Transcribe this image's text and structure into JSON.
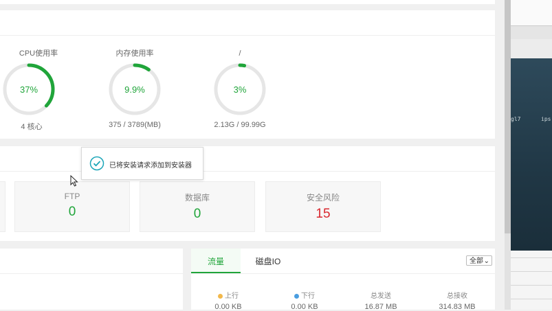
{
  "gauges": [
    {
      "title": "CPU使用率",
      "value": "37%",
      "percent": 37,
      "sub": "4 核心"
    },
    {
      "title": "内存使用率",
      "value": "9.9%",
      "percent": 9.9,
      "sub": "375 / 3789(MB)"
    },
    {
      "title": "/",
      "value": "3%",
      "percent": 3,
      "sub": "2.13G / 99.99G"
    }
  ],
  "tiles": [
    {
      "label": "FTP",
      "value": "0"
    },
    {
      "label": "数据库",
      "value": "0"
    },
    {
      "label": "安全风险",
      "value": "15"
    }
  ],
  "toast": {
    "message": "已将安装请求添加到安装器"
  },
  "traffic": {
    "tabs": [
      "流量",
      "磁盘IO"
    ],
    "range_select": "全部",
    "stats": [
      {
        "label": "上行",
        "value": "0.00 KB",
        "dot": "#f2b84b"
      },
      {
        "label": "下行",
        "value": "0.00 KB",
        "dot": "#4a9de0"
      },
      {
        "label": "总发送",
        "value": "16.87 MB"
      },
      {
        "label": "总接收",
        "value": "314.83 MB"
      }
    ]
  },
  "terminal": {
    "text1": "gl7",
    "text2": "ips"
  },
  "colors": {
    "accent": "#20a53a",
    "danger": "#d9272e",
    "track": "#e6e6e6"
  }
}
